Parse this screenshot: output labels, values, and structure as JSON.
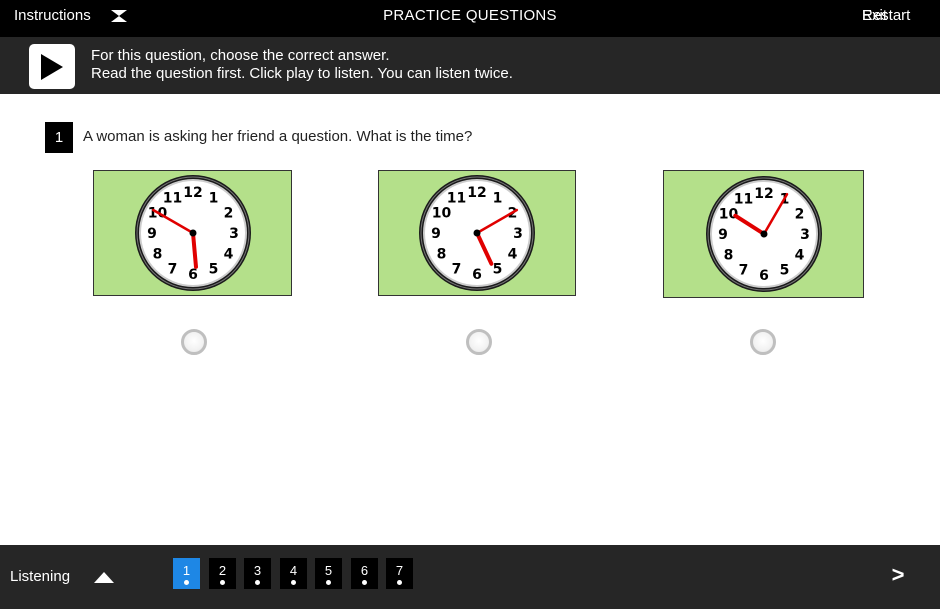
{
  "topbar": {
    "instructions_label": "Instructions",
    "title": "PRACTICE QUESTIONS",
    "exit_label": "Exit",
    "restart_label": "Restart"
  },
  "instruction_bar": {
    "line1": "For this question, choose the correct answer.",
    "line2": "Read the question first. Click play to listen. You can listen twice."
  },
  "question": {
    "number": "1",
    "text": "A woman is asking her friend a question. What is the time?",
    "options": [
      {
        "label": "clock-option-1",
        "hour": 5,
        "minute": 50,
        "selected": false
      },
      {
        "label": "clock-option-2",
        "hour": 5,
        "minute": 10,
        "selected": false
      },
      {
        "label": "clock-option-3",
        "hour": 10,
        "minute": 5,
        "selected": false
      }
    ]
  },
  "bottombar": {
    "section_label": "Listening",
    "questions": [
      "1",
      "2",
      "3",
      "4",
      "5",
      "6",
      "7"
    ],
    "active_question": "1",
    "next_label": ">"
  },
  "colors": {
    "option_bg": "#b4e08a",
    "active_question": "#1e87e5",
    "hand_color": "#e00000"
  },
  "clock_numbers": [
    "12",
    "1",
    "2",
    "3",
    "4",
    "5",
    "6",
    "7",
    "8",
    "9",
    "10",
    "11"
  ]
}
